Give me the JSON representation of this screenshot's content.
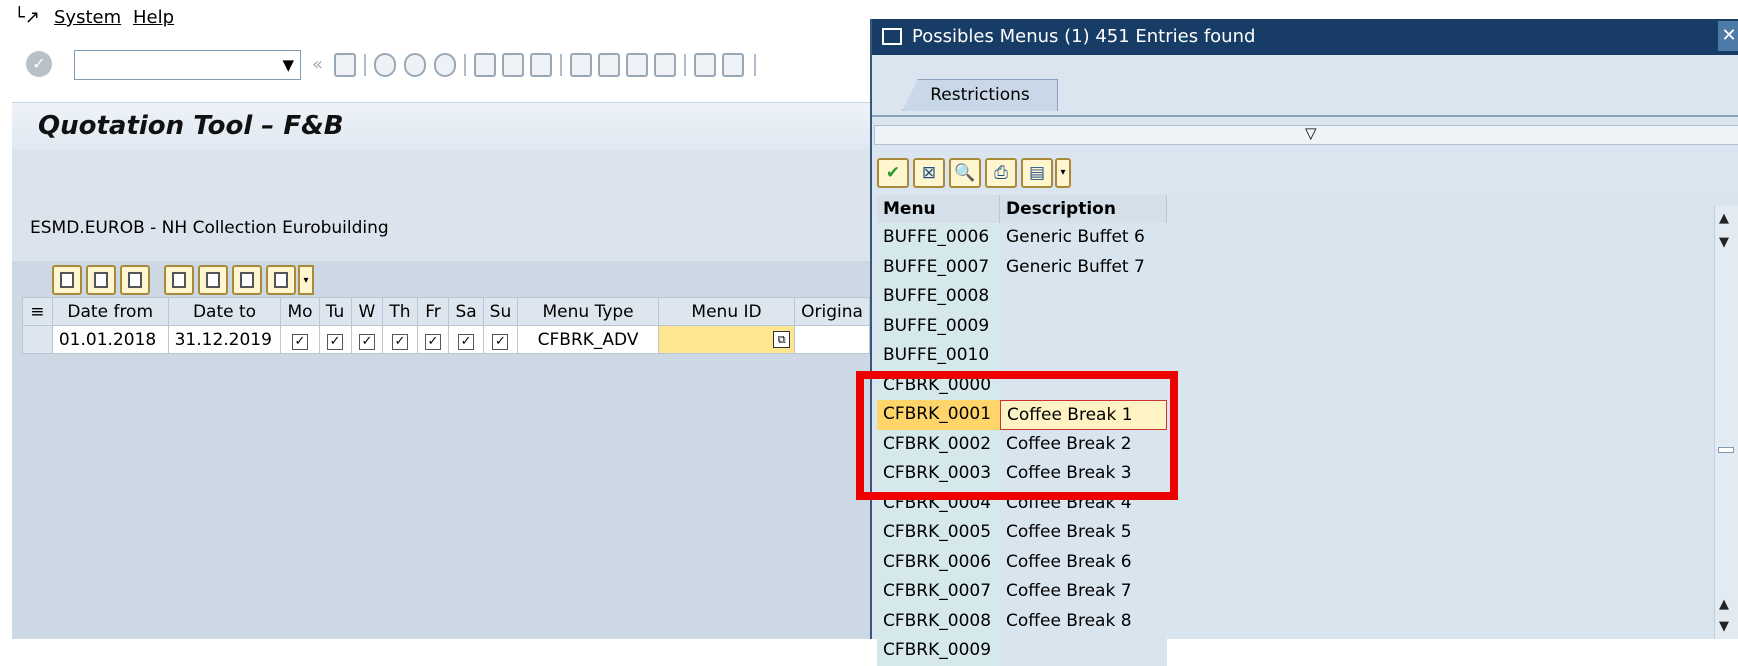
{
  "menubar": {
    "system": "System",
    "help": "Help"
  },
  "title": "Quotation Tool – F&B",
  "hotel": "ESMD.EUROB - NH Collection Eurobuilding",
  "grid": {
    "headers": [
      "Date from",
      "Date to",
      "Mo",
      "Tu",
      "W",
      "Th",
      "Fr",
      "Sa",
      "Su",
      "Menu Type",
      "Menu ID",
      "Origina"
    ],
    "row": {
      "date_from": "01.01.2018",
      "date_to": "31.12.2019",
      "menu_type": "CFBRK_ADV",
      "menu_id": ""
    }
  },
  "dialog": {
    "title": "Possibles Menus (1)  451 Entries found",
    "tab": "Restrictions",
    "columns": {
      "menu": "Menu",
      "description": "Description"
    },
    "rows": [
      {
        "menu": "BUFFE_0006",
        "desc": "Generic Buffet 6"
      },
      {
        "menu": "BUFFE_0007",
        "desc": "Generic Buffet 7"
      },
      {
        "menu": "BUFFE_0008",
        "desc": ""
      },
      {
        "menu": "BUFFE_0009",
        "desc": ""
      },
      {
        "menu": "BUFFE_0010",
        "desc": ""
      },
      {
        "menu": "CFBRK_0000",
        "desc": ""
      },
      {
        "menu": "CFBRK_0001",
        "desc": "Coffee Break 1"
      },
      {
        "menu": "CFBRK_0002",
        "desc": "Coffee Break 2"
      },
      {
        "menu": "CFBRK_0003",
        "desc": "Coffee Break 3"
      },
      {
        "menu": "CFBRK_0004",
        "desc": "Coffee Break 4"
      },
      {
        "menu": "CFBRK_0005",
        "desc": "Coffee Break 5"
      },
      {
        "menu": "CFBRK_0006",
        "desc": "Coffee Break 6"
      },
      {
        "menu": "CFBRK_0007",
        "desc": "Coffee Break 7"
      },
      {
        "menu": "CFBRK_0008",
        "desc": "Coffee Break 8"
      },
      {
        "menu": "CFBRK_0009",
        "desc": ""
      }
    ]
  },
  "colors": {
    "dialog_title_bg": "#173d66",
    "selection": "#ffd56a",
    "highlight": "#ee0000"
  }
}
